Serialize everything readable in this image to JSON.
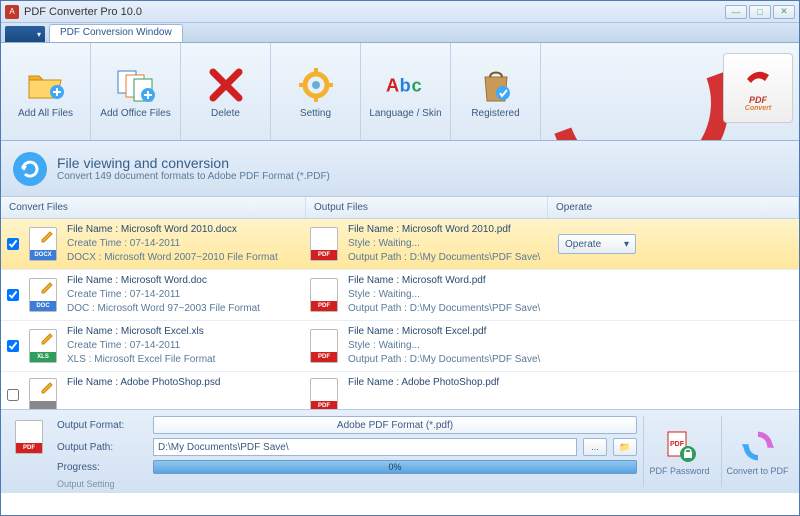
{
  "app": {
    "title": "PDF Converter Pro 10.0",
    "icon_letter": "A"
  },
  "tabs": {
    "main": "PDF Conversion Window"
  },
  "ribbon": {
    "add_all": "Add All Files",
    "add_office": "Add Office Files",
    "delete": "Delete",
    "setting": "Setting",
    "language": "Language / Skin",
    "registered": "Registered",
    "pdf_logo_top": "PDF",
    "pdf_logo_bottom": "Convert"
  },
  "banner": {
    "title": "File viewing and conversion",
    "subtitle": "Convert 149 document formats to Adobe PDF Format (*.PDF)"
  },
  "columns": {
    "c1": "Convert Files",
    "c2": "Output Files",
    "c3": "Operate"
  },
  "operate_btn": "Operate",
  "files": [
    {
      "selected": true,
      "checked": true,
      "ext": "DOCX",
      "ext_color": "#3b7dd8",
      "src_name": "File Name : Microsoft Word 2010.docx",
      "src_time": "Create Time : 07-14-2011",
      "src_fmt": "DOCX : Microsoft Word 2007~2010 File Format",
      "out_name": "File Name : Microsoft Word 2010.pdf",
      "out_style": "Style : Waiting...",
      "out_path": "Output Path : D:\\My Documents\\PDF Save\\",
      "show_operate": true
    },
    {
      "selected": false,
      "checked": true,
      "ext": "DOC",
      "ext_color": "#3b7dd8",
      "src_name": "File Name : Microsoft Word.doc",
      "src_time": "Create Time : 07-14-2011",
      "src_fmt": "DOC : Microsoft Word 97~2003 File Format",
      "out_name": "File Name : Microsoft Word.pdf",
      "out_style": "Style : Waiting...",
      "out_path": "Output Path : D:\\My Documents\\PDF Save\\",
      "show_operate": false
    },
    {
      "selected": false,
      "checked": true,
      "ext": "XLS",
      "ext_color": "#2e9e5b",
      "src_name": "File Name : Microsoft Excel.xls",
      "src_time": "Create Time : 07-14-2011",
      "src_fmt": "XLS : Microsoft Excel File Format",
      "out_name": "File Name : Microsoft Excel.pdf",
      "out_style": "Style : Waiting...",
      "out_path": "Output Path : D:\\My Documents\\PDF Save\\",
      "show_operate": false
    },
    {
      "selected": false,
      "checked": false,
      "ext": "",
      "ext_color": "#888",
      "src_name": "File Name : Adobe PhotoShop.psd",
      "src_time": "",
      "src_fmt": "",
      "out_name": "File Name : Adobe PhotoShop.pdf",
      "out_style": "",
      "out_path": "",
      "show_operate": false
    }
  ],
  "bottom": {
    "output_format_label": "Output Format:",
    "output_format_value": "Adobe PDF Format (*.pdf)",
    "output_path_label": "Output Path:",
    "output_path_value": "D:\\My Documents\\PDF Save\\",
    "progress_label": "Progress:",
    "progress_value": "0%",
    "output_setting": "Output Setting",
    "pdf_password": "PDF Password",
    "convert": "Convert to PDF",
    "browse": "...",
    "open_folder": "📁"
  }
}
